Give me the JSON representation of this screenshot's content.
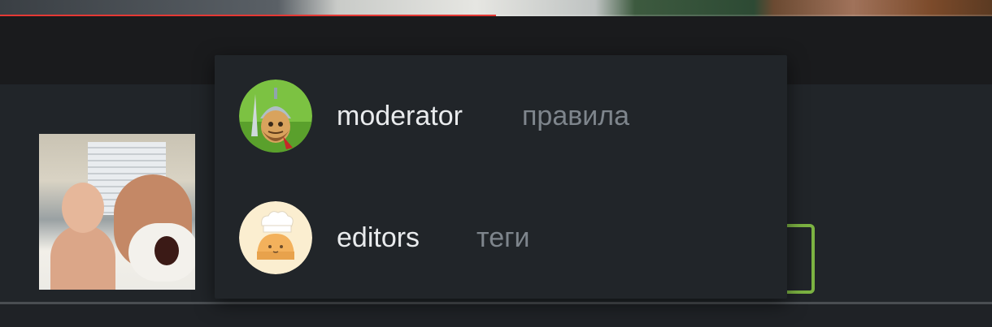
{
  "video": {
    "title": "",
    "progress_percent": 50
  },
  "mention_popup": {
    "items": [
      {
        "username": "moderator",
        "description": "правила",
        "avatar": "knight-avatar"
      },
      {
        "username": "editors",
        "description": "теги",
        "avatar": "chef-bread-avatar"
      }
    ]
  },
  "colors": {
    "background": "#1b1d20",
    "popup_bg": "#212529",
    "name_text": "#e9ebed",
    "desc_text": "#7e858c",
    "accent_green": "#7cb342",
    "progress_red": "#e53935"
  }
}
